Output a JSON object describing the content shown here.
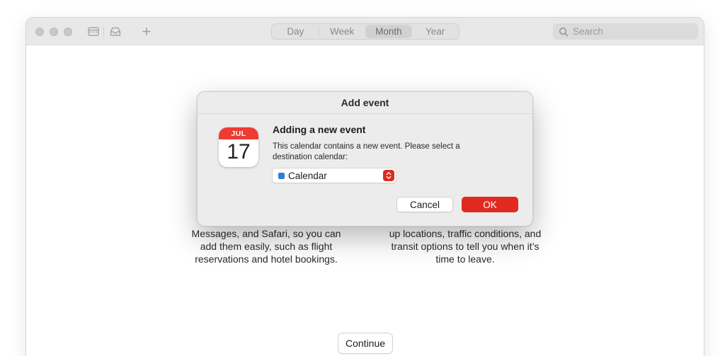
{
  "toolbar": {
    "view_tabs": [
      {
        "label": "Day",
        "active": false
      },
      {
        "label": "Week",
        "active": false
      },
      {
        "label": "Month",
        "active": true
      },
      {
        "label": "Year",
        "active": false
      }
    ],
    "search_placeholder": "Search"
  },
  "onboarding": {
    "left_feature_text_lines": [
      "Messages, and Safari, so you can",
      "add them easily, such as flight",
      "reservations and hotel bookings."
    ],
    "right_feature_text_lines": [
      "up locations, traffic conditions, and",
      "transit options to tell you when it’s",
      "time to leave."
    ],
    "continue_label": "Continue"
  },
  "dialog": {
    "title": "Add event",
    "icon": {
      "month": "JUL",
      "day": "17"
    },
    "heading": "Adding a new event",
    "body": "This calendar contains a new event. Please select a destination calendar:",
    "calendar_select": {
      "selected": "Calendar",
      "color": "#2f7fd6"
    },
    "cancel_label": "Cancel",
    "ok_label": "OK"
  },
  "colors": {
    "accent_red": "#e02a20",
    "calendar_red": "#ee3b34"
  }
}
